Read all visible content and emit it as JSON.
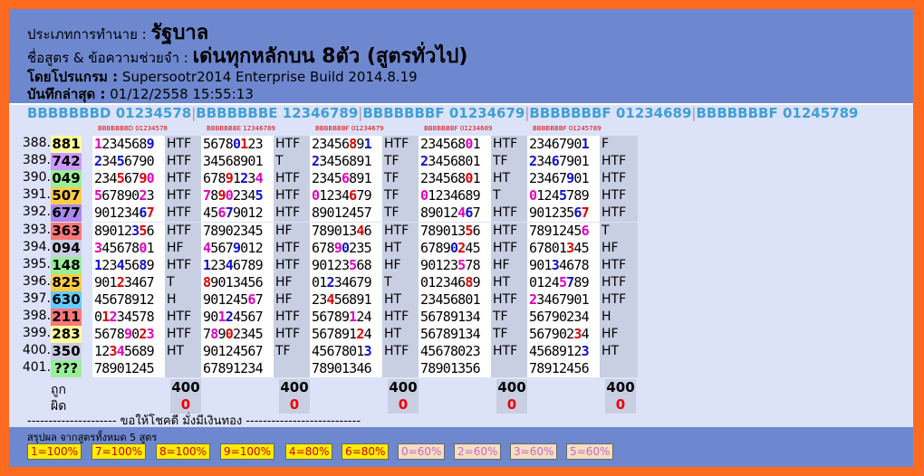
{
  "header": {
    "category_label": "ประเภทการทำนาย :",
    "category_value": "รัฐบาล",
    "formula_label": "ชื่อสูตร & ข้อความช่วยจำ :",
    "formula_value": "เด่นทุกหลักบน 8ตัว (สูตรทั่วไป)",
    "program_label": "โดยโปรแกรม :",
    "program_value": "Supersootr2014 Enterprise Build 2014.8.19",
    "saved_label": "บันทึกล่าสุด :",
    "saved_value": "01/12/2558 15:55:13"
  },
  "formulas": [
    "BBBBBBBD 01234578",
    "BBBBBBBE 12346789",
    "BBBBBBBF 01234679",
    "BBBBBBBF 01234689",
    "BBBBBBBF 01245789"
  ],
  "formula_separator": "|",
  "draws": [
    {
      "num": "388.",
      "res": "881",
      "bg": "#ffff99"
    },
    {
      "num": "389.",
      "res": "742",
      "bg": "#cc99ff"
    },
    {
      "num": "390.",
      "res": "049",
      "bg": "#99ee99"
    },
    {
      "num": "391.",
      "res": "507",
      "bg": "#ffcc44"
    },
    {
      "num": "392.",
      "res": "677",
      "bg": "#aa88ee"
    },
    {
      "num": "393.",
      "res": "363",
      "bg": "#ff7777"
    },
    {
      "num": "394.",
      "res": "094",
      "bg": "#c8cfe3"
    },
    {
      "num": "395.",
      "res": "148",
      "bg": "#99ee99"
    },
    {
      "num": "396.",
      "res": "825",
      "bg": "#ffcc44"
    },
    {
      "num": "397.",
      "res": "630",
      "bg": "#66ccff"
    },
    {
      "num": "398.",
      "res": "211",
      "bg": "#ff7777"
    },
    {
      "num": "399.",
      "res": "283",
      "bg": "#ffff99"
    },
    {
      "num": "400.",
      "res": "350",
      "bg": "#c8cfe3"
    },
    {
      "num": "401.",
      "res": "???",
      "bg": "#99ee99"
    }
  ],
  "columns": [
    {
      "header": "BBBBBBBD 01234578",
      "rows": [
        {
          "code": "12345689",
          "hits": [
            0,
            7
          ],
          "tag": "HTF"
        },
        {
          "code": "23456790",
          "hits": [
            0,
            3
          ],
          "tag": "HTF"
        },
        {
          "code": "23456790",
          "hits": [
            3,
            6,
            7
          ],
          "tag": "HTF"
        },
        {
          "code": "56789023",
          "hits": [
            0,
            6
          ],
          "tag": "HTF"
        },
        {
          "code": "90123467",
          "hits": [
            6,
            7
          ],
          "tag": "HTF"
        },
        {
          "code": "89012356",
          "hits": [
            5,
            6
          ],
          "tag": "HTF"
        },
        {
          "code": "34567801",
          "hits": [
            0,
            6
          ],
          "tag": "HF"
        },
        {
          "code": "12345689",
          "hits": [
            0,
            3,
            6
          ],
          "tag": "HTF"
        },
        {
          "code": "90123467",
          "hits": [
            3
          ],
          "tag": "T"
        },
        {
          "code": "45678912",
          "hits": [],
          "tag": "H"
        },
        {
          "code": "01234578",
          "hits": [
            1,
            2
          ],
          "tag": "HTF"
        },
        {
          "code": "56789023",
          "hits": [
            4,
            6,
            7
          ],
          "tag": "HTF"
        },
        {
          "code": "12345689",
          "hits": [
            2,
            3
          ],
          "tag": "HT"
        },
        {
          "code": "78901245",
          "hits": [],
          "tag": ""
        }
      ],
      "correct": "400",
      "wrong": "0"
    },
    {
      "header": "BBBBBBBE 12346789",
      "rows": [
        {
          "code": "56780123",
          "hits": [
            4,
            5
          ],
          "tag": "HTF"
        },
        {
          "code": "34568901",
          "hits": [],
          "tag": "T"
        },
        {
          "code": "67891234",
          "hits": [
            3,
            5,
            7
          ],
          "tag": "HTF"
        },
        {
          "code": "78902345",
          "hits": [
            0,
            2,
            3,
            7
          ],
          "tag": "HTF"
        },
        {
          "code": "45679012",
          "hits": [
            2,
            3
          ],
          "tag": "HTF"
        },
        {
          "code": "78902345",
          "hits": [],
          "tag": "HF"
        },
        {
          "code": "45679012",
          "hits": [
            0,
            4
          ],
          "tag": "HTF"
        },
        {
          "code": "12346789",
          "hits": [
            0,
            3
          ],
          "tag": "HTF"
        },
        {
          "code": "89013456",
          "hits": [
            0
          ],
          "tag": "HF"
        },
        {
          "code": "90124567",
          "hits": [
            6
          ],
          "tag": "HF"
        },
        {
          "code": "90124567",
          "hits": [
            2,
            3
          ],
          "tag": "HTF"
        },
        {
          "code": "78902345",
          "hits": [
            1,
            3
          ],
          "tag": "HTF"
        },
        {
          "code": "90124567",
          "hits": [],
          "tag": "TF"
        },
        {
          "code": "67891234",
          "hits": [],
          "tag": ""
        }
      ],
      "correct": "400",
      "wrong": "0"
    },
    {
      "header": "BBBBBBBF 01234679",
      "rows": [
        {
          "code": "23456891",
          "hits": [
            5,
            7
          ],
          "tag": "HTF"
        },
        {
          "code": "23456891",
          "hits": [
            0
          ],
          "tag": "TF"
        },
        {
          "code": "23456891",
          "hits": [
            4
          ],
          "tag": "TF"
        },
        {
          "code": "01234679",
          "hits": [
            0,
            5
          ],
          "tag": "TF"
        },
        {
          "code": "89012457",
          "hits": [],
          "tag": "TF"
        },
        {
          "code": "78901346",
          "hits": [
            6
          ],
          "tag": "HTF"
        },
        {
          "code": "67890235",
          "hits": [
            3,
            4
          ],
          "tag": "HT"
        },
        {
          "code": "90123568",
          "hits": [
            5
          ],
          "tag": "HF"
        },
        {
          "code": "01234679",
          "hits": [
            2
          ],
          "tag": "T"
        },
        {
          "code": "23456891",
          "hits": [
            2
          ],
          "tag": "HT"
        },
        {
          "code": "56789124",
          "hits": [
            5
          ],
          "tag": "HTF"
        },
        {
          "code": "56789124",
          "hits": [
            6
          ],
          "tag": "HT"
        },
        {
          "code": "45678013",
          "hits": [
            7
          ],
          "tag": "HTF"
        },
        {
          "code": "78901346",
          "hits": [],
          "tag": ""
        }
      ],
      "correct": "400",
      "wrong": "0"
    },
    {
      "header": "BBBBBBBF 01234689",
      "rows": [
        {
          "code": "23456801",
          "hits": [
            6
          ],
          "tag": "HTF"
        },
        {
          "code": "23456801",
          "hits": [
            0
          ],
          "tag": "TF"
        },
        {
          "code": "23456801",
          "hits": [
            6
          ],
          "tag": "HT"
        },
        {
          "code": "01234689",
          "hits": [
            0
          ],
          "tag": "T"
        },
        {
          "code": "89012467",
          "hits": [
            5,
            6
          ],
          "tag": "HTF"
        },
        {
          "code": "78901356",
          "hits": [
            6
          ],
          "tag": "HTF"
        },
        {
          "code": "67890245",
          "hits": [
            4,
            5
          ],
          "tag": "HTF"
        },
        {
          "code": "90123578",
          "hits": [
            5
          ],
          "tag": "HF"
        },
        {
          "code": "01234689",
          "hits": [
            6
          ],
          "tag": "HT"
        },
        {
          "code": "23456801",
          "hits": [],
          "tag": "HTF"
        },
        {
          "code": "56789134",
          "hits": [],
          "tag": "TF"
        },
        {
          "code": "56789134",
          "hits": [],
          "tag": "TF"
        },
        {
          "code": "45678023",
          "hits": [],
          "tag": "HTF"
        },
        {
          "code": "78901356",
          "hits": [],
          "tag": ""
        }
      ],
      "correct": "400",
      "wrong": "0"
    },
    {
      "header": "BBBBBBBF 01245789",
      "rows": [
        {
          "code": "23467901",
          "hits": [
            7
          ],
          "tag": "F"
        },
        {
          "code": "23467901",
          "hits": [
            0,
            3
          ],
          "tag": "HTF"
        },
        {
          "code": "23467901",
          "hits": [
            5
          ],
          "tag": "HTF"
        },
        {
          "code": "01245789",
          "hits": [
            0,
            4
          ],
          "tag": "HTF"
        },
        {
          "code": "90123567",
          "hits": [
            6,
            7
          ],
          "tag": "HTF"
        },
        {
          "code": "78912456",
          "hits": [
            7
          ],
          "tag": "T"
        },
        {
          "code": "67801345",
          "hits": [
            5
          ],
          "tag": "HF"
        },
        {
          "code": "90134678",
          "hits": [
            3
          ],
          "tag": "HTF"
        },
        {
          "code": "01245789",
          "hits": [
            4,
            5
          ],
          "tag": "HTF"
        },
        {
          "code": "23467901",
          "hits": [
            0
          ],
          "tag": "HTF"
        },
        {
          "code": "56790234",
          "hits": [],
          "tag": "H"
        },
        {
          "code": "56790234",
          "hits": [
            6
          ],
          "tag": "HF"
        },
        {
          "code": "45689123",
          "hits": [
            7
          ],
          "tag": "HT"
        },
        {
          "code": "78912456",
          "hits": [],
          "tag": ""
        }
      ],
      "correct": "400",
      "wrong": "0"
    }
  ],
  "labels": {
    "correct": "ถูก",
    "wrong": "ผิด"
  },
  "footer_dash": "--------------------- ขอให้โชคดี มั่งมีเงินทอง ---------------------------",
  "summary": {
    "title": "สรุปผล จากสูตรทั้งหมด 5 สูตร",
    "items": [
      {
        "label": "1=100%",
        "bg": "#ffee00",
        "fg": "#cc0000"
      },
      {
        "label": "7=100%",
        "bg": "#ffee00",
        "fg": "#cc0000"
      },
      {
        "label": "8=100%",
        "bg": "#ffee00",
        "fg": "#cc0000"
      },
      {
        "label": "9=100%",
        "bg": "#ffee00",
        "fg": "#cc0000"
      },
      {
        "label": "4=80%",
        "bg": "#ffee00",
        "fg": "#cc0000"
      },
      {
        "label": "6=80%",
        "bg": "#ffee00",
        "fg": "#cc0000"
      },
      {
        "label": "0=60%",
        "bg": "#f3e0c0",
        "fg": "#cc66cc"
      },
      {
        "label": "2=60%",
        "bg": "#f3e0c0",
        "fg": "#cc66cc"
      },
      {
        "label": "3=60%",
        "bg": "#f3e0c0",
        "fg": "#cc66cc"
      },
      {
        "label": "5=60%",
        "bg": "#f3e0c0",
        "fg": "#cc66cc"
      }
    ]
  },
  "colors": {
    "hit_blue": "#1111cc",
    "hit_magenta": "#e000c0",
    "hit_red": "#dd0000",
    "wrong_red": "#ee0000"
  }
}
